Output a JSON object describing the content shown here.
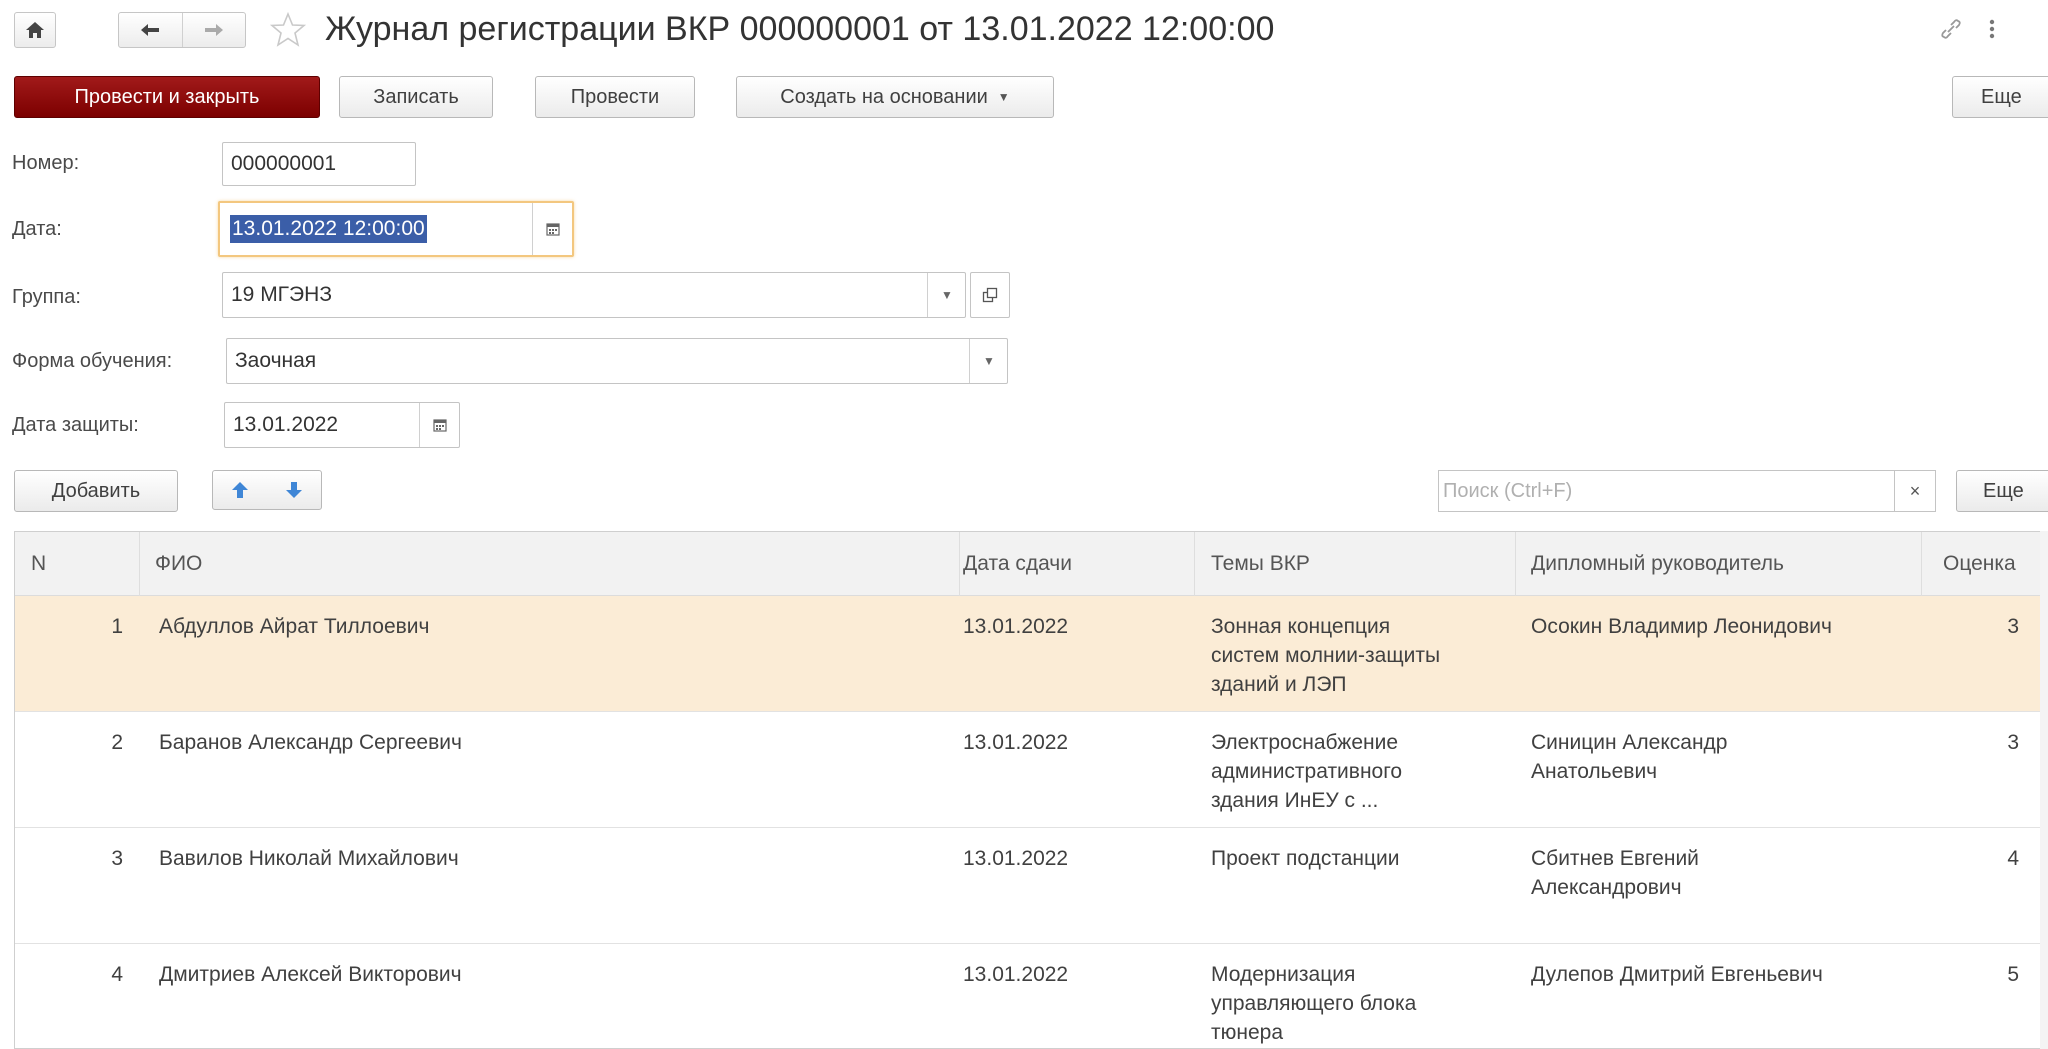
{
  "window": {
    "title": "Журнал регистрации ВКР 000000001 от 13.01.2022 12:00:00"
  },
  "toolbar": {
    "post_close_label": "Провести и закрыть",
    "save_label": "Записать",
    "post_label": "Провести",
    "create_based_label": "Создать на основании",
    "more_label": "Еще"
  },
  "form": {
    "number_label": "Номер:",
    "number_value": "000000001",
    "date_label": "Дата:",
    "date_value": "13.01.2022 12:00:00",
    "group_label": "Группа:",
    "group_value": "19 МГЭНЗ",
    "study_form_label": "Форма обучения:",
    "study_form_value": "Заочная",
    "defense_date_label": "Дата защиты:",
    "defense_date_value": "13.01.2022"
  },
  "table_toolbar": {
    "add_label": "Добавить",
    "search_placeholder": "Поиск (Ctrl+F)",
    "clear_label": "×",
    "more_label": "Еще"
  },
  "table": {
    "columns": [
      "N",
      "ФИО",
      "Дата сдачи",
      "Темы ВКР",
      "Дипломный руководитель",
      "Оценка"
    ],
    "rows": [
      {
        "n": "1",
        "fio": "Абдуллов Айрат Тиллоевич",
        "date": "13.01.2022",
        "topic": [
          "Зонная концепция",
          "систем молнии-защиты",
          "зданий и ЛЭП"
        ],
        "supervisor": [
          "Осокин Владимир Леонидович"
        ],
        "grade": "3"
      },
      {
        "n": "2",
        "fio": "Баранов Александр Сергеевич",
        "date": "13.01.2022",
        "topic": [
          "Электроснабжение",
          "административного",
          "здания ИнЕУ с ..."
        ],
        "supervisor": [
          "Синицин Александр",
          "Анатольевич"
        ],
        "grade": "3"
      },
      {
        "n": "3",
        "fio": "Вавилов Николай Михайлович",
        "date": "13.01.2022",
        "topic": [
          "Проект подстанции"
        ],
        "supervisor": [
          "Сбитнев Евгений",
          "Александрович"
        ],
        "grade": "4"
      },
      {
        "n": "4",
        "fio": "Дмитриев Алексей Викторович",
        "date": "13.01.2022",
        "topic": [
          "Модернизация",
          "управляющего блока",
          "тюнера"
        ],
        "supervisor": [
          "Дулепов Дмитрий Евгеньевич"
        ],
        "grade": "5"
      }
    ]
  },
  "colors": {
    "primary_button": "#8b0c0c",
    "selected_row": "#fbecd6",
    "focus_border": "#f3c77f",
    "text_selection": "#3b5ea8",
    "arrow_blue": "#3f86d6"
  },
  "icons": [
    "home-icon",
    "back-arrow-icon",
    "forward-arrow-icon",
    "favorite-star-icon",
    "link-icon",
    "more-dots-icon",
    "calendar-icon",
    "dropdown-arrow-icon",
    "open-icon",
    "move-up-icon",
    "move-down-icon"
  ]
}
